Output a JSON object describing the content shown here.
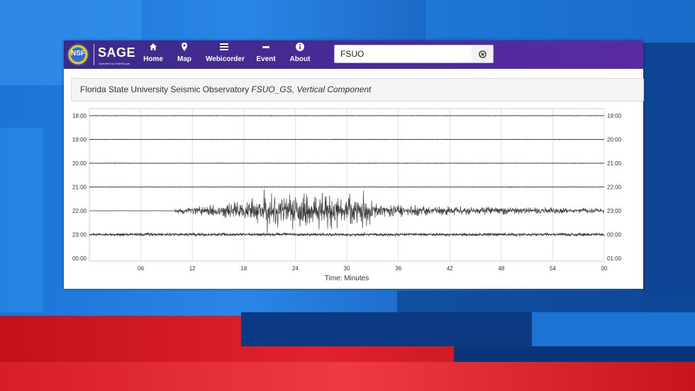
{
  "navbar": {
    "logo_mark": "NSF",
    "logo_text": "SAGE",
    "logo_sub": "Operated by EarthScope",
    "items": [
      {
        "label": "Home",
        "icon": "home-icon"
      },
      {
        "label": "Map",
        "icon": "map-pin-icon"
      },
      {
        "label": "Webicorder",
        "icon": "list-icon"
      },
      {
        "label": "Event",
        "icon": "minus-icon"
      },
      {
        "label": "About",
        "icon": "info-icon"
      }
    ],
    "search": {
      "value": "FSUO"
    },
    "clear_icon": "clear-circle-icon"
  },
  "title": {
    "station": "Florida State University Seismic Observatory",
    "channel": "FSUO_GS, Vertical Component"
  },
  "chart_data": {
    "type": "line",
    "left_ticks": [
      "18:00",
      "19:00",
      "20:00",
      "21:00",
      "22:00",
      "23:00",
      "00:00"
    ],
    "right_ticks": [
      "19:00",
      "20:00",
      "21:00",
      "22:00",
      "23:00",
      "00:00",
      "01:00"
    ],
    "x_ticks": [
      "06",
      "12",
      "18",
      "24",
      "30",
      "36",
      "42",
      "48",
      "54",
      "00"
    ],
    "x_tick_minutes": [
      6,
      12,
      18,
      24,
      30,
      36,
      42,
      48,
      54,
      60
    ],
    "xlabel": "Time: Minutes",
    "xlim": [
      0,
      60
    ],
    "grid": true,
    "traces": [
      {
        "row": 0,
        "start": 0,
        "end": 60,
        "quake": false
      },
      {
        "row": 1,
        "start": 0,
        "end": 60,
        "quake": false
      },
      {
        "row": 2,
        "start": 0,
        "end": 60,
        "quake": false
      },
      {
        "row": 3,
        "start": 0,
        "end": 60,
        "quake": false
      },
      {
        "row": 4,
        "start": 0,
        "end": 60,
        "quake": true,
        "onset": 10,
        "peak_start": 19,
        "peak_end": 33
      },
      {
        "row": 5,
        "start": 0,
        "end": 60,
        "quake": false,
        "noisy": true
      }
    ],
    "trace_color": "#3a3a3a"
  }
}
